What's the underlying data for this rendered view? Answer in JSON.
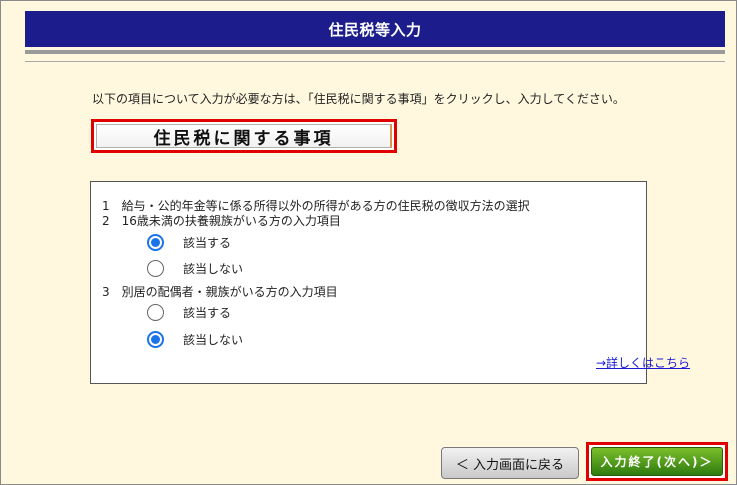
{
  "header": {
    "title": "住民税等入力"
  },
  "instruction": "以下の項目について入力が必要な方は、「住民税に関する事項」をクリックし、入力してください。",
  "resident_tax_button": "住民税に関する事項",
  "summary": {
    "item1": "1　給与・公的年金等に係る所得以外の所得がある方の住民税の徴収方法の選択",
    "item2": "2　16歳未満の扶養親族がいる方の入力項目",
    "item2_options": {
      "yes": "該当する",
      "no": "該当しない",
      "selected": "yes"
    },
    "item3": "3　別居の配偶者・親族がいる方の入力項目",
    "item3_options": {
      "yes": "該当する",
      "no": "該当しない",
      "selected": "no"
    },
    "detail_link": "→詳しくはこちら"
  },
  "footer": {
    "back_label": "＜ 入力画面に戻る",
    "next_label": "入力終了(次へ)＞"
  },
  "colors": {
    "header_bg": "#1c1c8c",
    "highlight_border": "#e00000",
    "next_button": "#4e9a1d",
    "radio_checked": "#1a73e8",
    "link": "#1a1ad6"
  }
}
